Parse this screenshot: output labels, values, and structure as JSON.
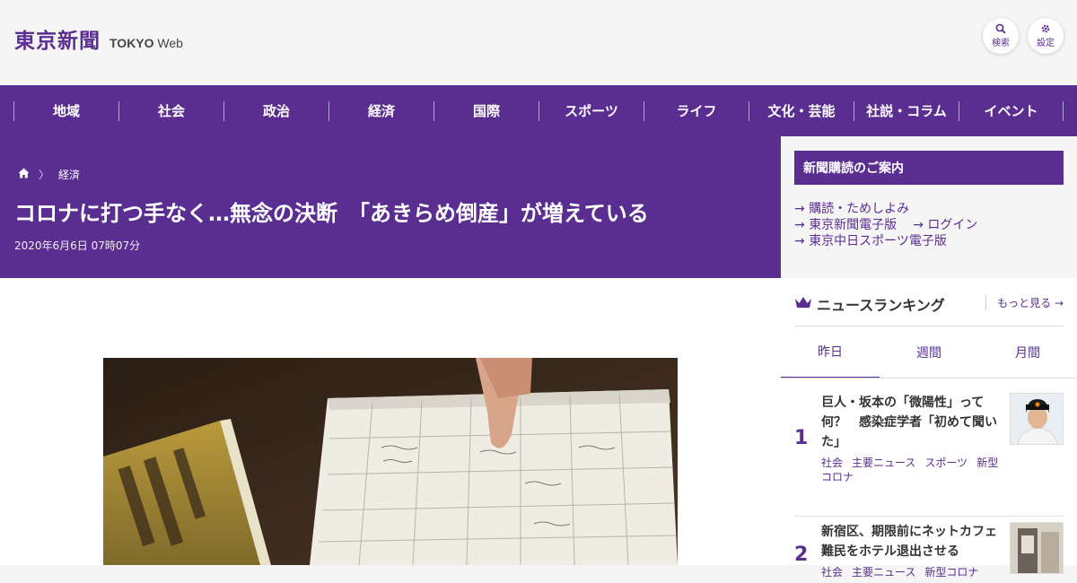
{
  "header": {
    "logo_main": "東京新聞",
    "logo_sub_bold": "TOKYO",
    "logo_sub": "Web",
    "search_label": "検索",
    "settings_label": "設定",
    "search_icon": "search-icon",
    "settings_icon": "gear-icon"
  },
  "nav": {
    "items": [
      "地域",
      "社会",
      "政治",
      "経済",
      "国際",
      "スポーツ",
      "ライフ",
      "文化・芸能",
      "社説・コラム",
      "イベント"
    ]
  },
  "article": {
    "breadcrumb_category": "経済",
    "title": "コロナに打つ手なく…無念の決断　「あきらめ倒産」が増えている",
    "date": "2020年6月6日 07時07分"
  },
  "sidebar": {
    "subscribe_heading": "新聞購読のご案内",
    "links": [
      "購読・ためしよみ",
      "東京新聞電子版",
      "ログイン",
      "東京中日スポーツ電子版"
    ],
    "ranking_title": "ニュースランキング",
    "more_label": "もっと見る",
    "tabs": [
      "昨日",
      "週間",
      "月間"
    ],
    "active_tab": "昨日",
    "ranking": [
      {
        "rank": "1",
        "title": "巨人・坂本の「微陽性」って何？　感染症学者「初めて聞いた」",
        "tags": [
          "社会",
          "主要ニュース",
          "スポーツ",
          "新型コロナ"
        ]
      },
      {
        "rank": "2",
        "title": "新宿区、期限前にネットカフェ難民をホテル退出させる",
        "tags": [
          "社会",
          "主要ニュース",
          "新型コロナ"
        ]
      }
    ]
  },
  "colors": {
    "brand": "#5a2e91",
    "background": "#f5f5f5"
  }
}
